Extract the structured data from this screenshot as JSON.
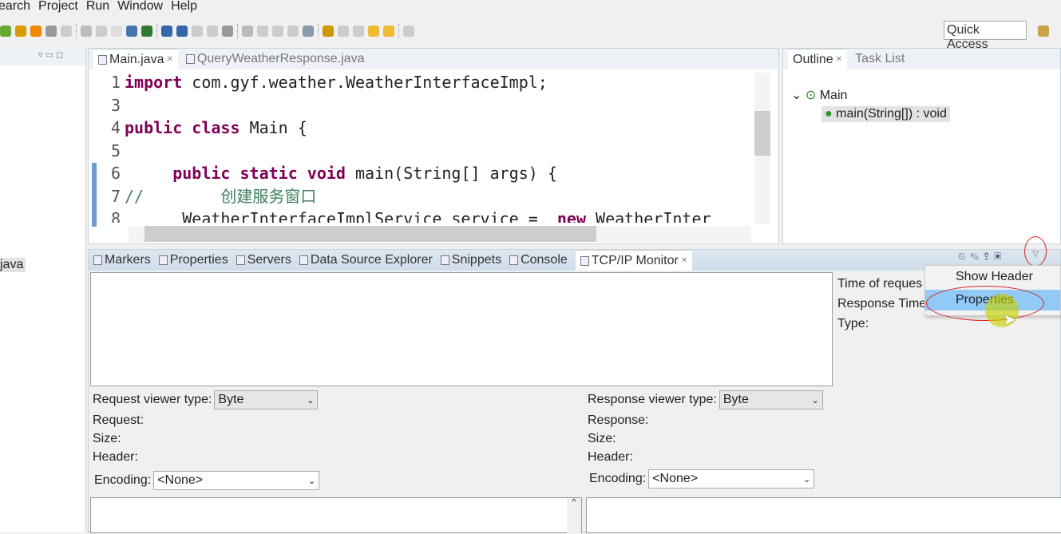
{
  "menubar": [
    "earch",
    "Project",
    "Run",
    "Window",
    "Help"
  ],
  "toolbar": {
    "quick_access": "Quick Access"
  },
  "editor": {
    "tabs": [
      {
        "label": "Main.java",
        "active": true
      },
      {
        "label": "QueryWeatherResponse.java",
        "active": false
      }
    ],
    "lines": [
      {
        "n": "1",
        "parts": [
          [
            "kw",
            "import"
          ],
          [
            "",
            "com.gyf.weather.WeatherInterfaceImpl;"
          ]
        ],
        "marker": "+"
      },
      {
        "n": "3",
        "parts": []
      },
      {
        "n": "4",
        "parts": [
          [
            "kw",
            "public class"
          ],
          [
            "",
            "Main {"
          ]
        ]
      },
      {
        "n": "5",
        "parts": []
      },
      {
        "n": "6",
        "parts": [
          [
            "",
            "    "
          ],
          [
            "kw",
            "public static void"
          ],
          [
            "",
            "main(String[] args) {"
          ]
        ],
        "marker": "-"
      },
      {
        "n": "7",
        "parts": [
          [
            "cm",
            "//        创建服务窗口"
          ]
        ]
      },
      {
        "n": "8",
        "parts": [
          [
            "",
            "      WeatherInterfaceImplService service = "
          ],
          [
            "kw",
            "new"
          ],
          [
            "",
            "WeatherInter"
          ]
        ]
      }
    ]
  },
  "left_panel": {
    "item": "java"
  },
  "outline": {
    "tabs": [
      "Outline",
      "Task List"
    ],
    "class": "Main",
    "method": "main(String[]) : void"
  },
  "bottom": {
    "tabs": [
      "Markers",
      "Properties",
      "Servers",
      "Data Source Explorer",
      "Snippets",
      "Console",
      "TCP/IP Monitor"
    ],
    "active_tab": "TCP/IP Monitor",
    "info": [
      "Time of reques",
      "Response Time",
      "Type:"
    ],
    "request": {
      "viewer_label": "Request viewer type:",
      "viewer_value": "Byte",
      "labels": [
        "Request:",
        "Size:",
        "Header:"
      ],
      "encoding_label": "Encoding:",
      "encoding_value": "<None>"
    },
    "response": {
      "viewer_label": "Response viewer type:",
      "viewer_value": "Byte",
      "labels": [
        "Response:",
        "Size:",
        "Header:"
      ],
      "encoding_label": "Encoding:",
      "encoding_value": "<None>"
    }
  },
  "dropdown_menu": {
    "items": [
      "Show Header",
      "Properties"
    ],
    "highlighted": "Properties"
  },
  "colors": {
    "keyword": "#7f0055",
    "comment": "#3f7f5f",
    "highlight": "#91c9f7",
    "annotation": "#e02020"
  }
}
